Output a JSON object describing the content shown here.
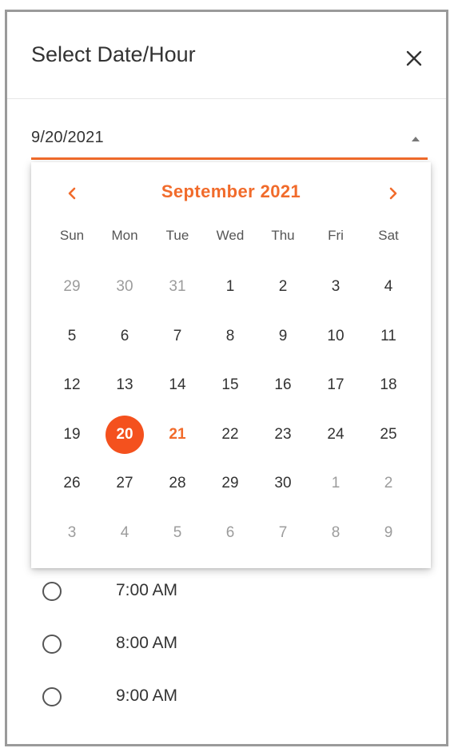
{
  "dialog": {
    "title": "Select Date/Hour",
    "close_icon": "close-icon"
  },
  "date_field": {
    "value": "9/20/2021",
    "dropdown_icon": "caret-up-icon"
  },
  "calendar": {
    "month_year": "September 2021",
    "prev_icon": "chevron-left-icon",
    "next_icon": "chevron-right-icon",
    "weekdays": [
      "Sun",
      "Mon",
      "Tue",
      "Wed",
      "Thu",
      "Fri",
      "Sat"
    ],
    "weeks": [
      [
        "29",
        "30",
        "31",
        "1",
        "2",
        "3",
        "4"
      ],
      [
        "5",
        "6",
        "7",
        "8",
        "9",
        "10",
        "11"
      ],
      [
        "12",
        "13",
        "14",
        "15",
        "16",
        "17",
        "18"
      ],
      [
        "19",
        "20",
        "21",
        "22",
        "23",
        "24",
        "25"
      ],
      [
        "26",
        "27",
        "28",
        "29",
        "30",
        "1",
        "2"
      ],
      [
        "3",
        "4",
        "5",
        "6",
        "7",
        "8",
        "9"
      ]
    ],
    "selected_day": "20",
    "today_day": "21"
  },
  "times": [
    {
      "label": "7:00 AM",
      "selected": false
    },
    {
      "label": "8:00 AM",
      "selected": false
    },
    {
      "label": "9:00 AM",
      "selected": false
    }
  ],
  "colors": {
    "accent": "#f16b2b",
    "selected_fill": "#f4511e",
    "text": "#333333",
    "muted_text": "#9c9c9c"
  }
}
